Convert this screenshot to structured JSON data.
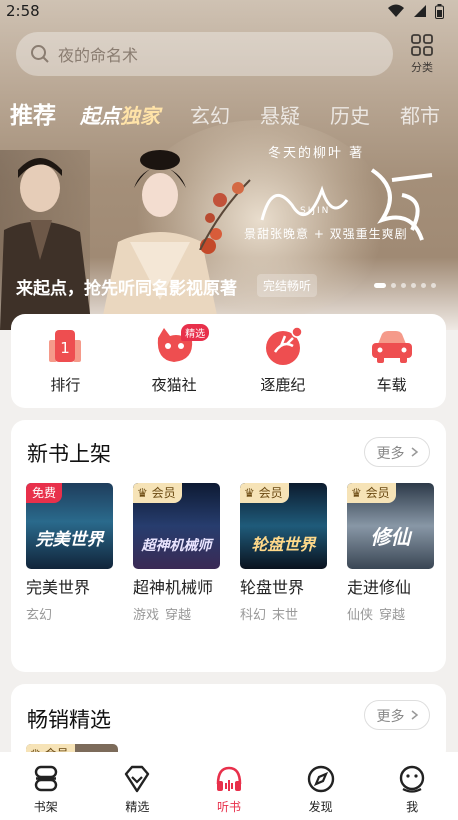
{
  "status": {
    "time": "2:58"
  },
  "search": {
    "placeholder": "夜的命名术"
  },
  "category": {
    "label": "分类"
  },
  "tabs": [
    {
      "label": "推荐",
      "active": true
    },
    {
      "label_a": "起点",
      "label_b": "独家",
      "special": true
    },
    {
      "label": "玄幻"
    },
    {
      "label": "悬疑"
    },
    {
      "label": "历史"
    },
    {
      "label": "都市"
    }
  ],
  "banner": {
    "author": "冬天的柳叶 著",
    "title_pinyin": "SIJIN",
    "slogan": "景甜张晚意 + 双强重生爽剧",
    "caption": "来起点，抢先听同名影视原著",
    "tag": "完结畅听",
    "dots_total": 6,
    "dots_active": 1
  },
  "quick": [
    {
      "label": "排行",
      "icon": "rank-icon"
    },
    {
      "label": "夜猫社",
      "icon": "cat-icon",
      "badge": "精选"
    },
    {
      "label": "逐鹿纪",
      "icon": "deer-icon"
    },
    {
      "label": "车载",
      "icon": "car-icon"
    }
  ],
  "new_books": {
    "title": "新书上架",
    "more": "更多",
    "items": [
      {
        "name": "完美世界",
        "tags": [
          "玄幻"
        ],
        "badge": "免费",
        "cover_text": "完美世界"
      },
      {
        "name": "超神机械师",
        "tags": [
          "游戏",
          "穿越"
        ],
        "badge": "会员",
        "cover_text": "超神机械师"
      },
      {
        "name": "轮盘世界",
        "tags": [
          "科幻",
          "末世"
        ],
        "badge": "会员",
        "cover_text": "轮盘世界"
      },
      {
        "name": "走进修仙",
        "tags": [
          "仙侠",
          "穿越"
        ],
        "badge": "会员",
        "cover_text": "修仙"
      }
    ]
  },
  "bestsellers": {
    "title": "畅销精选",
    "more": "更多",
    "peek_badge": "会员"
  },
  "nav": [
    {
      "label": "书架",
      "icon": "bookshelf-icon"
    },
    {
      "label": "精选",
      "icon": "diamond-icon"
    },
    {
      "label": "听书",
      "icon": "headphones-icon",
      "active": true
    },
    {
      "label": "发现",
      "icon": "compass-icon"
    },
    {
      "label": "我",
      "icon": "profile-icon"
    }
  ],
  "colors": {
    "accent": "#e8304b",
    "vip_gold": "#f6e3b7"
  }
}
